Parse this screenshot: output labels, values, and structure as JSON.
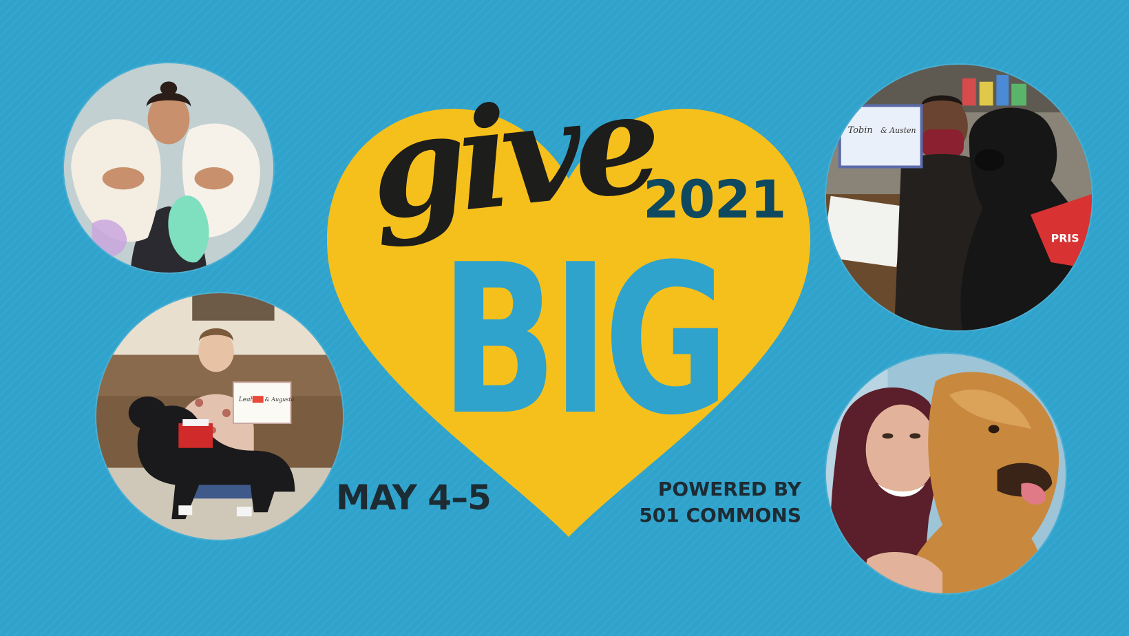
{
  "logo": {
    "give": "give",
    "big": "BIG",
    "year": "2021"
  },
  "event": {
    "dates": "MAY 4–5",
    "powered_line1": "POWERED BY",
    "powered_line2": "501 COMMONS"
  },
  "photos": {
    "photo_2": {
      "certificate_name": "Leah",
      "certificate_dog": "& Augusta"
    },
    "photo_3": {
      "certificate_name": "Tobin",
      "certificate_dog": "& Austen",
      "vest_text": "PRIS"
    }
  },
  "colors": {
    "background": "#2fa3cc",
    "heart": "#f6c01c",
    "give": "#1d1d1b",
    "big": "#2fa3cc",
    "year": "#0e4960",
    "text_dark": "#1d2b33"
  }
}
